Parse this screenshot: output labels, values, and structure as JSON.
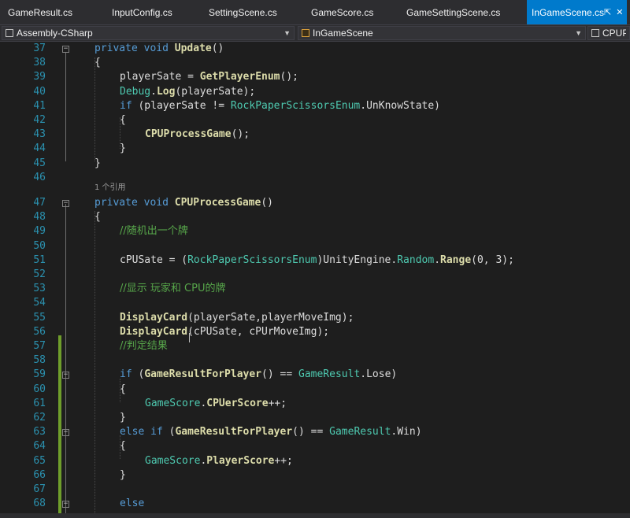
{
  "tabs": [
    {
      "label": "GameResult.cs"
    },
    {
      "label": "InputConfig.cs"
    },
    {
      "label": "SettingScene.cs"
    },
    {
      "label": "GameScore.cs"
    },
    {
      "label": "GameSettingScene.cs"
    },
    {
      "label": "InGameScene.cs",
      "active": true
    }
  ],
  "tab_icons": {
    "pin": "⇱",
    "close": "✕"
  },
  "navbar": {
    "project": "Assembly-CSharp",
    "class": "InGameScene",
    "member": "CPUPr"
  },
  "editor": {
    "code_lens": "1 个引用",
    "lines": [
      {
        "n": "37",
        "tokens": [
          [
            "kw",
            "private "
          ],
          [
            "kw",
            "void "
          ],
          [
            "fn",
            "Update"
          ],
          [
            "pl",
            "()"
          ]
        ],
        "indent": 0
      },
      {
        "n": "38",
        "tokens": [
          [
            "pl",
            "{"
          ]
        ],
        "indent": 0
      },
      {
        "n": "39",
        "tokens": [
          [
            "pl",
            "playerSate = "
          ],
          [
            "fn",
            "GetPlayerEnum"
          ],
          [
            "pl",
            "();"
          ]
        ],
        "indent": 1
      },
      {
        "n": "40",
        "tokens": [
          [
            "ty",
            "Debug"
          ],
          [
            "pl",
            "."
          ],
          [
            "fn",
            "Log"
          ],
          [
            "pl",
            "(playerSate);"
          ]
        ],
        "indent": 1
      },
      {
        "n": "41",
        "tokens": [
          [
            "kw",
            "if "
          ],
          [
            "pl",
            "(playerSate != "
          ],
          [
            "ty",
            "RockPaperScissorsEnum"
          ],
          [
            "pl",
            ".UnKnowState)"
          ]
        ],
        "indent": 1
      },
      {
        "n": "42",
        "tokens": [
          [
            "pl",
            "{"
          ]
        ],
        "indent": 1
      },
      {
        "n": "43",
        "tokens": [
          [
            "fn",
            "CPUProcessGame"
          ],
          [
            "pl",
            "();"
          ]
        ],
        "indent": 2
      },
      {
        "n": "44",
        "tokens": [
          [
            "pl",
            "}"
          ]
        ],
        "indent": 1
      },
      {
        "n": "45",
        "tokens": [
          [
            "pl",
            "}"
          ]
        ],
        "indent": 0
      },
      {
        "n": "46",
        "tokens": [],
        "indent": 0
      },
      {
        "n": "47",
        "tokens": [
          [
            "kw",
            "private "
          ],
          [
            "kw",
            "void "
          ],
          [
            "fn",
            "CPUProcessGame"
          ],
          [
            "pl",
            "()"
          ]
        ],
        "indent": 0
      },
      {
        "n": "48",
        "tokens": [
          [
            "pl",
            "{"
          ]
        ],
        "indent": 0
      },
      {
        "n": "49",
        "tokens": [
          [
            "cm",
            "//随机出一个牌"
          ]
        ],
        "indent": 1
      },
      {
        "n": "50",
        "tokens": [],
        "indent": 0
      },
      {
        "n": "51",
        "tokens": [
          [
            "pl",
            "cPUSate = ("
          ],
          [
            "ty",
            "RockPaperScissorsEnum"
          ],
          [
            "pl",
            ")UnityEngine."
          ],
          [
            "ty",
            "Random"
          ],
          [
            "pl",
            "."
          ],
          [
            "fn",
            "Range"
          ],
          [
            "pl",
            "(0, 3);"
          ]
        ],
        "indent": 1
      },
      {
        "n": "52",
        "tokens": [],
        "indent": 0
      },
      {
        "n": "53",
        "tokens": [
          [
            "cm",
            "//显示 玩家和 CPU的牌"
          ]
        ],
        "indent": 1
      },
      {
        "n": "54",
        "tokens": [],
        "indent": 0
      },
      {
        "n": "55",
        "tokens": [
          [
            "fn",
            "DisplayCard"
          ],
          [
            "pl",
            "(playerSate,playerMoveImg);"
          ]
        ],
        "indent": 1
      },
      {
        "n": "56",
        "tokens": [
          [
            "fn",
            "DisplayCard"
          ],
          [
            "pl",
            "(cPUSate, cPUrMoveImg);"
          ]
        ],
        "indent": 1
      },
      {
        "n": "57",
        "tokens": [
          [
            "cm",
            "//判定结果"
          ]
        ],
        "indent": 1
      },
      {
        "n": "58",
        "tokens": [],
        "indent": 0
      },
      {
        "n": "59",
        "tokens": [
          [
            "kw",
            "if "
          ],
          [
            "pl",
            "("
          ],
          [
            "fn",
            "GameResultForPlayer"
          ],
          [
            "pl",
            "() == "
          ],
          [
            "ty",
            "GameResult"
          ],
          [
            "pl",
            ".Lose)"
          ]
        ],
        "indent": 1
      },
      {
        "n": "60",
        "tokens": [
          [
            "pl",
            "{"
          ]
        ],
        "indent": 1
      },
      {
        "n": "61",
        "tokens": [
          [
            "ty",
            "GameScore"
          ],
          [
            "pl",
            "."
          ],
          [
            "fn",
            "CPUerScore"
          ],
          [
            "pl",
            "++;"
          ]
        ],
        "indent": 2
      },
      {
        "n": "62",
        "tokens": [
          [
            "pl",
            "}"
          ]
        ],
        "indent": 1
      },
      {
        "n": "63",
        "tokens": [
          [
            "kw",
            "else if "
          ],
          [
            "pl",
            "("
          ],
          [
            "fn",
            "GameResultForPlayer"
          ],
          [
            "pl",
            "() == "
          ],
          [
            "ty",
            "GameResult"
          ],
          [
            "pl",
            ".Win)"
          ]
        ],
        "indent": 1
      },
      {
        "n": "64",
        "tokens": [
          [
            "pl",
            "{"
          ]
        ],
        "indent": 1
      },
      {
        "n": "65",
        "tokens": [
          [
            "ty",
            "GameScore"
          ],
          [
            "pl",
            "."
          ],
          [
            "fn",
            "PlayerScore"
          ],
          [
            "pl",
            "++;"
          ]
        ],
        "indent": 2
      },
      {
        "n": "66",
        "tokens": [
          [
            "pl",
            "}"
          ]
        ],
        "indent": 1
      },
      {
        "n": "67",
        "tokens": [],
        "indent": 0
      },
      {
        "n": "68",
        "tokens": [
          [
            "kw",
            "else"
          ]
        ],
        "indent": 1
      }
    ]
  }
}
